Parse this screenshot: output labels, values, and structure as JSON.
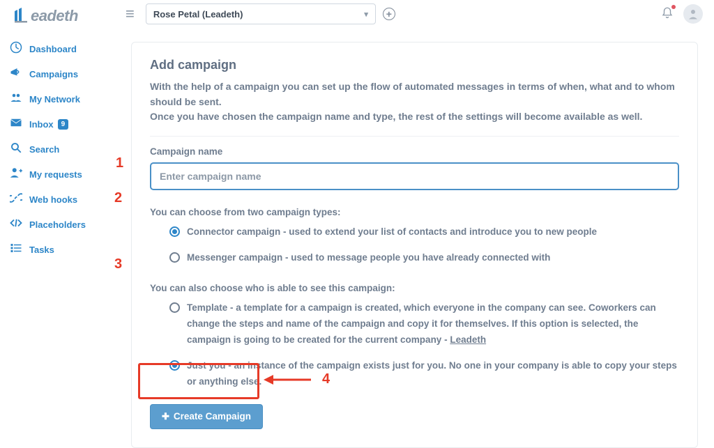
{
  "brand": "eadeth",
  "sidebar": {
    "items": [
      {
        "label": "Dashboard"
      },
      {
        "label": "Campaigns"
      },
      {
        "label": "My Network"
      },
      {
        "label": "Inbox",
        "badge": "9"
      },
      {
        "label": "Search"
      },
      {
        "label": "My requests"
      },
      {
        "label": "Web hooks"
      },
      {
        "label": "Placeholders"
      },
      {
        "label": "Tasks"
      }
    ]
  },
  "topbar": {
    "account": "Rose Petal (Leadeth)"
  },
  "panel": {
    "title": "Add campaign",
    "intro1": "With the help of a campaign you can set up the flow of automated messages in terms of when, what and to whom should be sent.",
    "intro2": "Once you have chosen the campaign name and type, the rest of the settings will become available as well.",
    "name_label": "Campaign name",
    "name_placeholder": "Enter campaign name",
    "type_label": "You can choose from two campaign types:",
    "type_options": [
      {
        "selected": true,
        "label": "Connector campaign - used to extend your list of contacts and introduce you to new people"
      },
      {
        "selected": false,
        "label": "Messenger campaign - used to message people you have already connected with"
      }
    ],
    "visibility_label": "You can also choose who is able to see this campaign:",
    "visibility_options": [
      {
        "selected": false,
        "label_a": "Template - a template for a campaign is created, which everyone in the company can see. Coworkers can change the steps and name of the campaign and copy it for themselves. If this option is selected, the campaign is going to be created for the current company - ",
        "label_b": "Leadeth"
      },
      {
        "selected": true,
        "label_a": "Just you - an instance of the campaign exists just for you. No one in your company is able to copy your steps or anything else."
      }
    ],
    "create_label": "Create Campaign"
  },
  "annotations": {
    "n1": "1",
    "n2": "2",
    "n3": "3",
    "n4": "4"
  }
}
